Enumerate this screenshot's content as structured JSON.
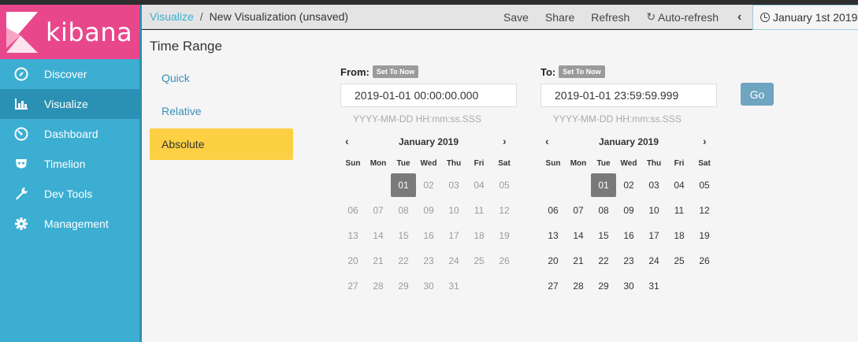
{
  "app": {
    "name": "kibana"
  },
  "sidebar": {
    "items": [
      {
        "label": "Discover",
        "icon": "compass-icon"
      },
      {
        "label": "Visualize",
        "icon": "bar-chart-icon",
        "active": true
      },
      {
        "label": "Dashboard",
        "icon": "dashboard-gauge-icon"
      },
      {
        "label": "Timelion",
        "icon": "timelion-mask-icon"
      },
      {
        "label": "Dev Tools",
        "icon": "wrench-icon"
      },
      {
        "label": "Management",
        "icon": "gear-icon"
      }
    ]
  },
  "topbar": {
    "breadcrumb_link": "Visualize",
    "breadcrumb_sep": "/",
    "breadcrumb_current": "New Visualization (unsaved)",
    "save": "Save",
    "share": "Share",
    "refresh": "Refresh",
    "auto_refresh": "Auto-refresh",
    "date_display": "January 1st 2019"
  },
  "time_range": {
    "title": "Time Range",
    "modes": [
      "Quick",
      "Relative",
      "Absolute"
    ],
    "active_mode": "Absolute",
    "from": {
      "label": "From:",
      "set_now": "Set To Now",
      "value": "2019-01-01 00:00:00.000",
      "format_hint": "YYYY-MM-DD HH:mm:ss.SSS",
      "month": "January 2019",
      "selected_day": "01"
    },
    "to": {
      "label": "To:",
      "set_now": "Set To Now",
      "value": "2019-01-01 23:59:59.999",
      "format_hint": "YYYY-MM-DD HH:mm:ss.SSS",
      "month": "January 2019",
      "selected_day": "01"
    },
    "weekdays": [
      "Sun",
      "Mon",
      "Tue",
      "Wed",
      "Thu",
      "Fri",
      "Sat"
    ],
    "go": "Go"
  },
  "colors": {
    "sidebar": "#3caed2",
    "logo_bg": "#e8488b",
    "active_mode": "#fdd043",
    "selected_day": "#7a7a7a",
    "go_button": "#6ea5c0"
  }
}
